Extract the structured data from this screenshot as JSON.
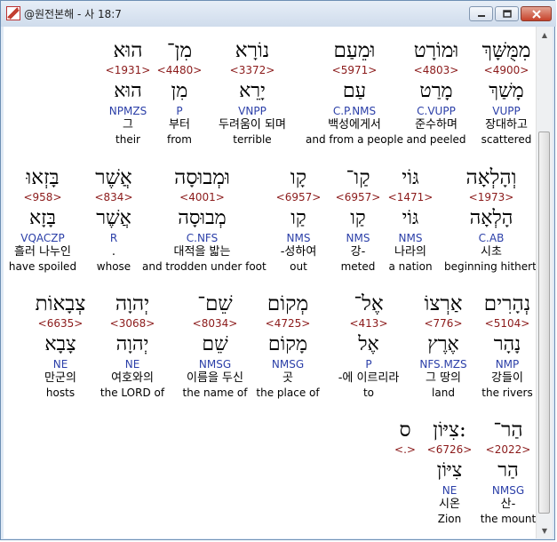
{
  "window": {
    "title": "@원전본해 - 사 18:7"
  },
  "rows": [
    [
      {
        "heb": "מִמֻּשָּׁךְ",
        "strong": "<4900>",
        "lemma": "מָשַׁךְ",
        "parse": "VUPP",
        "kor": "장대하고",
        "eng": "scattered"
      },
      {
        "heb": "וּמוֹרָט",
        "strong": "<4803>",
        "lemma": "מָרַט",
        "parse": "C.VUPP",
        "kor": "준수하며",
        "eng": "and peeled"
      },
      {
        "heb": "וּמֵעַם",
        "strong": "<5971>",
        "lemma": "עַם",
        "parse": "C.P.NMS",
        "kor": "백성에게서",
        "eng": "and from a people"
      },
      {
        "heb": "נוֹרָא",
        "strong": "<3372>",
        "lemma": "יָרֵא",
        "parse": "VNPP",
        "kor": "두려움이 되며",
        "eng": "terrible"
      },
      {
        "heb": "מִן־",
        "strong": "<4480>",
        "lemma": "מִן",
        "parse": "P",
        "kor": "부터",
        "eng": "from"
      },
      {
        "heb": "הוּא",
        "strong": "<1931>",
        "lemma": "הוּא",
        "parse": "NPMZS",
        "kor": "그",
        "eng": "their"
      }
    ],
    [
      {
        "heb": "וְהָלְאָה",
        "strong": "<1973>",
        "lemma": "הָלְאָה",
        "parse": "C.AB",
        "kor": "시초",
        "eng": "beginning hitherto"
      },
      {
        "heb": "גּוֹי",
        "strong": "<1471>",
        "lemma": "גּוֹי",
        "parse": "NMS",
        "kor": "나라의",
        "eng": "a nation"
      },
      {
        "heb": "קַו־",
        "strong": "<6957>",
        "lemma": "קַו",
        "parse": "NMS",
        "kor": "강-",
        "eng": "meted"
      },
      {
        "heb": "קָו",
        "strong": "<6957>",
        "lemma": "קַו",
        "parse": "NMS",
        "kor": "-성하여",
        "eng": "out"
      },
      {
        "heb": "וּמְבוּסָה",
        "strong": "<4001>",
        "lemma": "מְבוּסָה",
        "parse": "C.NFS",
        "kor": "대적을 밟는",
        "eng": "and trodden under foot"
      },
      {
        "heb": "אֲשֶׁר",
        "strong": "<834>",
        "lemma": "אֲשֶׁר",
        "parse": "R",
        "kor": ".",
        "eng": "whose"
      },
      {
        "heb": "בָּזְאוּ",
        "strong": "<958>",
        "lemma": "בָּזָא",
        "parse": "VQACZP",
        "kor": "흘러 나누인",
        "eng": "have spoiled"
      }
    ],
    [
      {
        "heb": "נְהָרִים",
        "strong": "<5104>",
        "lemma": "נָהָר",
        "parse": "NMP",
        "kor": "강들이",
        "eng": "the rivers"
      },
      {
        "heb": "אַרְצוֹ",
        "strong": "<776>",
        "lemma": "אֶרֶץ",
        "parse": "NFS.MZS",
        "kor": "그 땅의",
        "eng": "land"
      },
      {
        "heb": "אֶל־",
        "strong": "<413>",
        "lemma": "אֶל",
        "parse": "P",
        "kor": "-에 이르리라",
        "eng": "to"
      },
      {
        "heb": "מְקוֹם",
        "strong": "<4725>",
        "lemma": "מָקוֹם",
        "parse": "NMSG",
        "kor": "곳",
        "eng": "the place of"
      },
      {
        "heb": "שֵׁם־",
        "strong": "<8034>",
        "lemma": "שֵׁם",
        "parse": "NMSG",
        "kor": "이름을 두신",
        "eng": "the name of"
      },
      {
        "heb": "יְהוָה",
        "strong": "<3068>",
        "lemma": "יְהוָה",
        "parse": "NE",
        "kor": "여호와의",
        "eng": "the LORD of"
      },
      {
        "heb": "צְבָאוֹת",
        "strong": "<6635>",
        "lemma": "צָבָא",
        "parse": "NE",
        "kor": "만군의",
        "eng": "hosts"
      }
    ],
    [
      {
        "heb": "הַר־",
        "strong": "<2022>",
        "lemma": "הַר",
        "parse": "NMSG",
        "kor": "산-",
        "eng": "the mount"
      },
      {
        "heb": "צִיּוֹן:",
        "strong": "<6726>",
        "lemma": "צִיּוֹן",
        "parse": "NE",
        "kor": "시온",
        "eng": "Zion"
      },
      {
        "heb": "ס",
        "strong": "<.>",
        "lemma": "",
        "parse": "",
        "kor": "",
        "eng": ""
      }
    ]
  ]
}
